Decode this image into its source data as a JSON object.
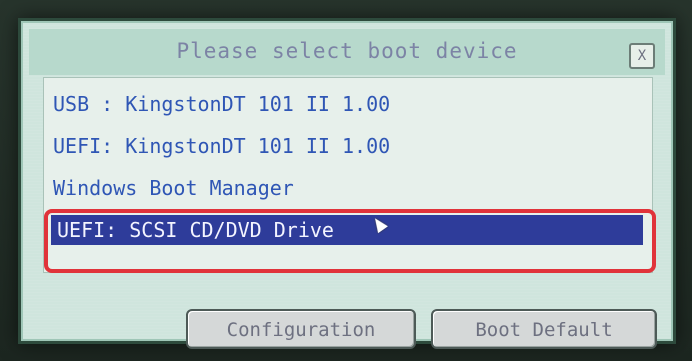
{
  "dialog": {
    "title": "Please select boot device",
    "close_label": "X"
  },
  "boot_list": {
    "items": [
      {
        "label": "USB : KingstonDT 101 II 1.00",
        "selected": false
      },
      {
        "label": "UEFI: KingstonDT 101 II 1.00",
        "selected": false
      },
      {
        "label": "Windows Boot Manager",
        "selected": false
      },
      {
        "label": "UEFI: SCSI CD/DVD Drive",
        "selected": true
      }
    ]
  },
  "buttons": {
    "configuration_label": "Configuration",
    "boot_default_label": "Boot Default"
  },
  "colors": {
    "dialog_bg": "#cfe5dd",
    "title_text": "#7c83a5",
    "item_text": "#2f56b5",
    "selected_bg": "#2e3c9a",
    "highlight_outline": "#e0333a"
  },
  "icons": {
    "close": "close-icon",
    "cursor": "mouse-cursor-icon"
  }
}
